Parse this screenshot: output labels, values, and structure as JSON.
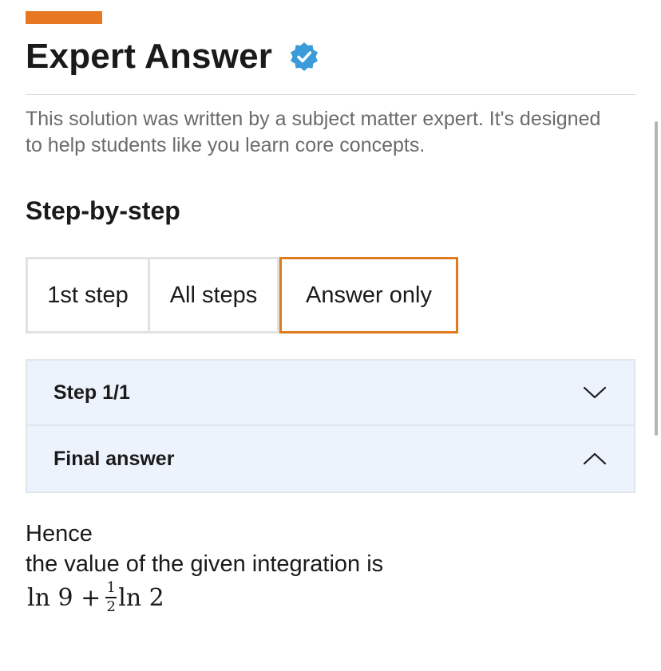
{
  "header": {
    "title": "Expert Answer",
    "verified_icon": "verified-badge-icon",
    "subtitle": "This solution was written by a subject matter expert. It's designed to help students like you learn core concepts."
  },
  "colors": {
    "accent": "#e87722",
    "verified": "#3b9ad9",
    "accordion_bg": "#edf3fd"
  },
  "steps": {
    "heading": "Step-by-step",
    "tabs": [
      {
        "label": "1st step",
        "selected": false
      },
      {
        "label": "All steps",
        "selected": false
      },
      {
        "label": "Answer only",
        "selected": true
      }
    ]
  },
  "accordion": {
    "step": {
      "label": "Step 1/1",
      "icon": "chevron-down-icon",
      "expanded": false
    },
    "final": {
      "label": "Final answer",
      "icon": "chevron-up-icon",
      "expanded": true
    }
  },
  "answer": {
    "line1": "Hence",
    "line2": "the value of the given integration is",
    "math": {
      "part1": "ln 9 + ",
      "frac_num": "1",
      "frac_den": "2",
      "part2": "ln 2"
    }
  }
}
